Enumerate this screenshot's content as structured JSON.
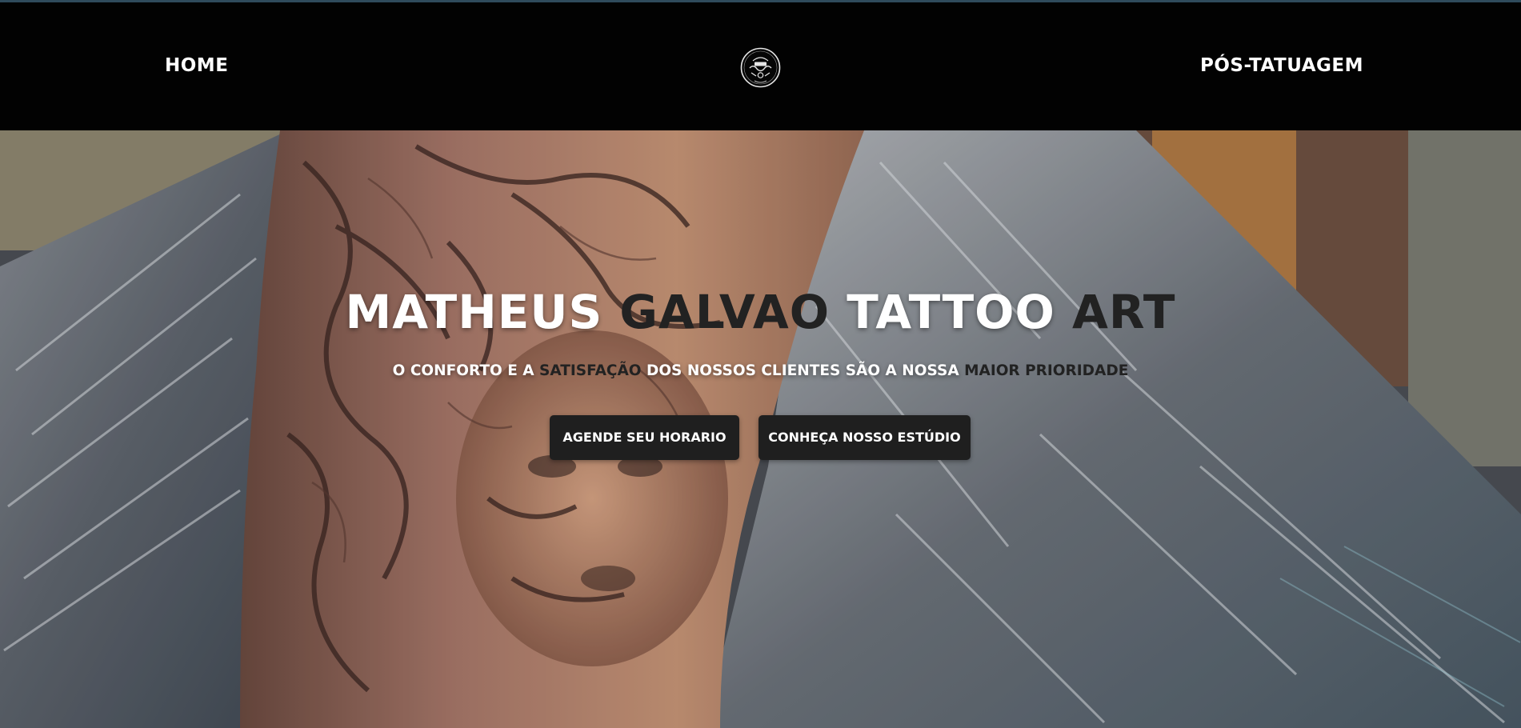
{
  "nav": {
    "home_label": "HOME",
    "post_label": "PÓS-TATUAGEM",
    "logo": {
      "icon": "galvao-tattoo-logo",
      "text_top": "GALVAO",
      "text_mid": "TATTOO"
    }
  },
  "hero": {
    "title": {
      "part1": "MATHEUS ",
      "part2": "GALVAO",
      "part3": " TATTOO ",
      "part4": "ART"
    },
    "subtitle": {
      "part1": "O CONFORTO E A ",
      "part2": "SATISFAÇÃO",
      "part3": " DOS NOSSOS CLIENTES SÃO A NOSSA ",
      "part4": "MAIOR PRIORIDADE"
    },
    "buttons": {
      "schedule_label": "AGENDE SEU HORARIO",
      "studio_label": "CONHEÇA NOSSO ESTÚDIO"
    },
    "background_image": "tattoo-arm-medusa-snakes-photo"
  },
  "colors": {
    "navbar": "#020202",
    "accent_line": "#2f4b5c",
    "button_bg": "#1f1f1f",
    "text_light": "#ffffff",
    "text_dark": "#222222"
  }
}
